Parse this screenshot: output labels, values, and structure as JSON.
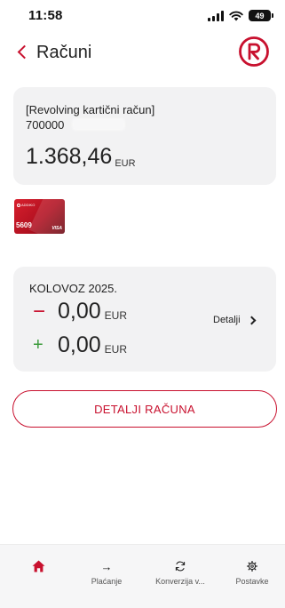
{
  "status_bar": {
    "time": "11:58",
    "battery": "49"
  },
  "header": {
    "title": "Računi",
    "back_icon": "chevron-left-icon",
    "logo_icon": "bank-logo-r-icon"
  },
  "account": {
    "name": "[Revolving kartični račun]",
    "number": "700000",
    "balance": "1.368,46",
    "currency": "EUR"
  },
  "card": {
    "brand": "ADDIKO",
    "last4": "5609",
    "network": "VISA"
  },
  "month": {
    "label": "KOLOVOZ 2025.",
    "outflow": {
      "sign": "−",
      "amount": "0,00",
      "currency": "EUR"
    },
    "inflow": {
      "sign": "+",
      "amount": "0,00",
      "currency": "EUR"
    },
    "details_label": "Detalji"
  },
  "account_details_button": "DETALJI RAČUNA",
  "nav": {
    "items": [
      {
        "label": "",
        "icon": "home-icon",
        "active": true
      },
      {
        "label": "Plaćanje",
        "icon": "arrow-right-icon"
      },
      {
        "label": "Konverzija v...",
        "icon": "refresh-icon"
      },
      {
        "label": "Postavke",
        "icon": "gear-icon"
      }
    ]
  },
  "colors": {
    "accent": "#c8102e",
    "card_bg": "#f2f2f3",
    "positive": "#3a9a3a"
  }
}
